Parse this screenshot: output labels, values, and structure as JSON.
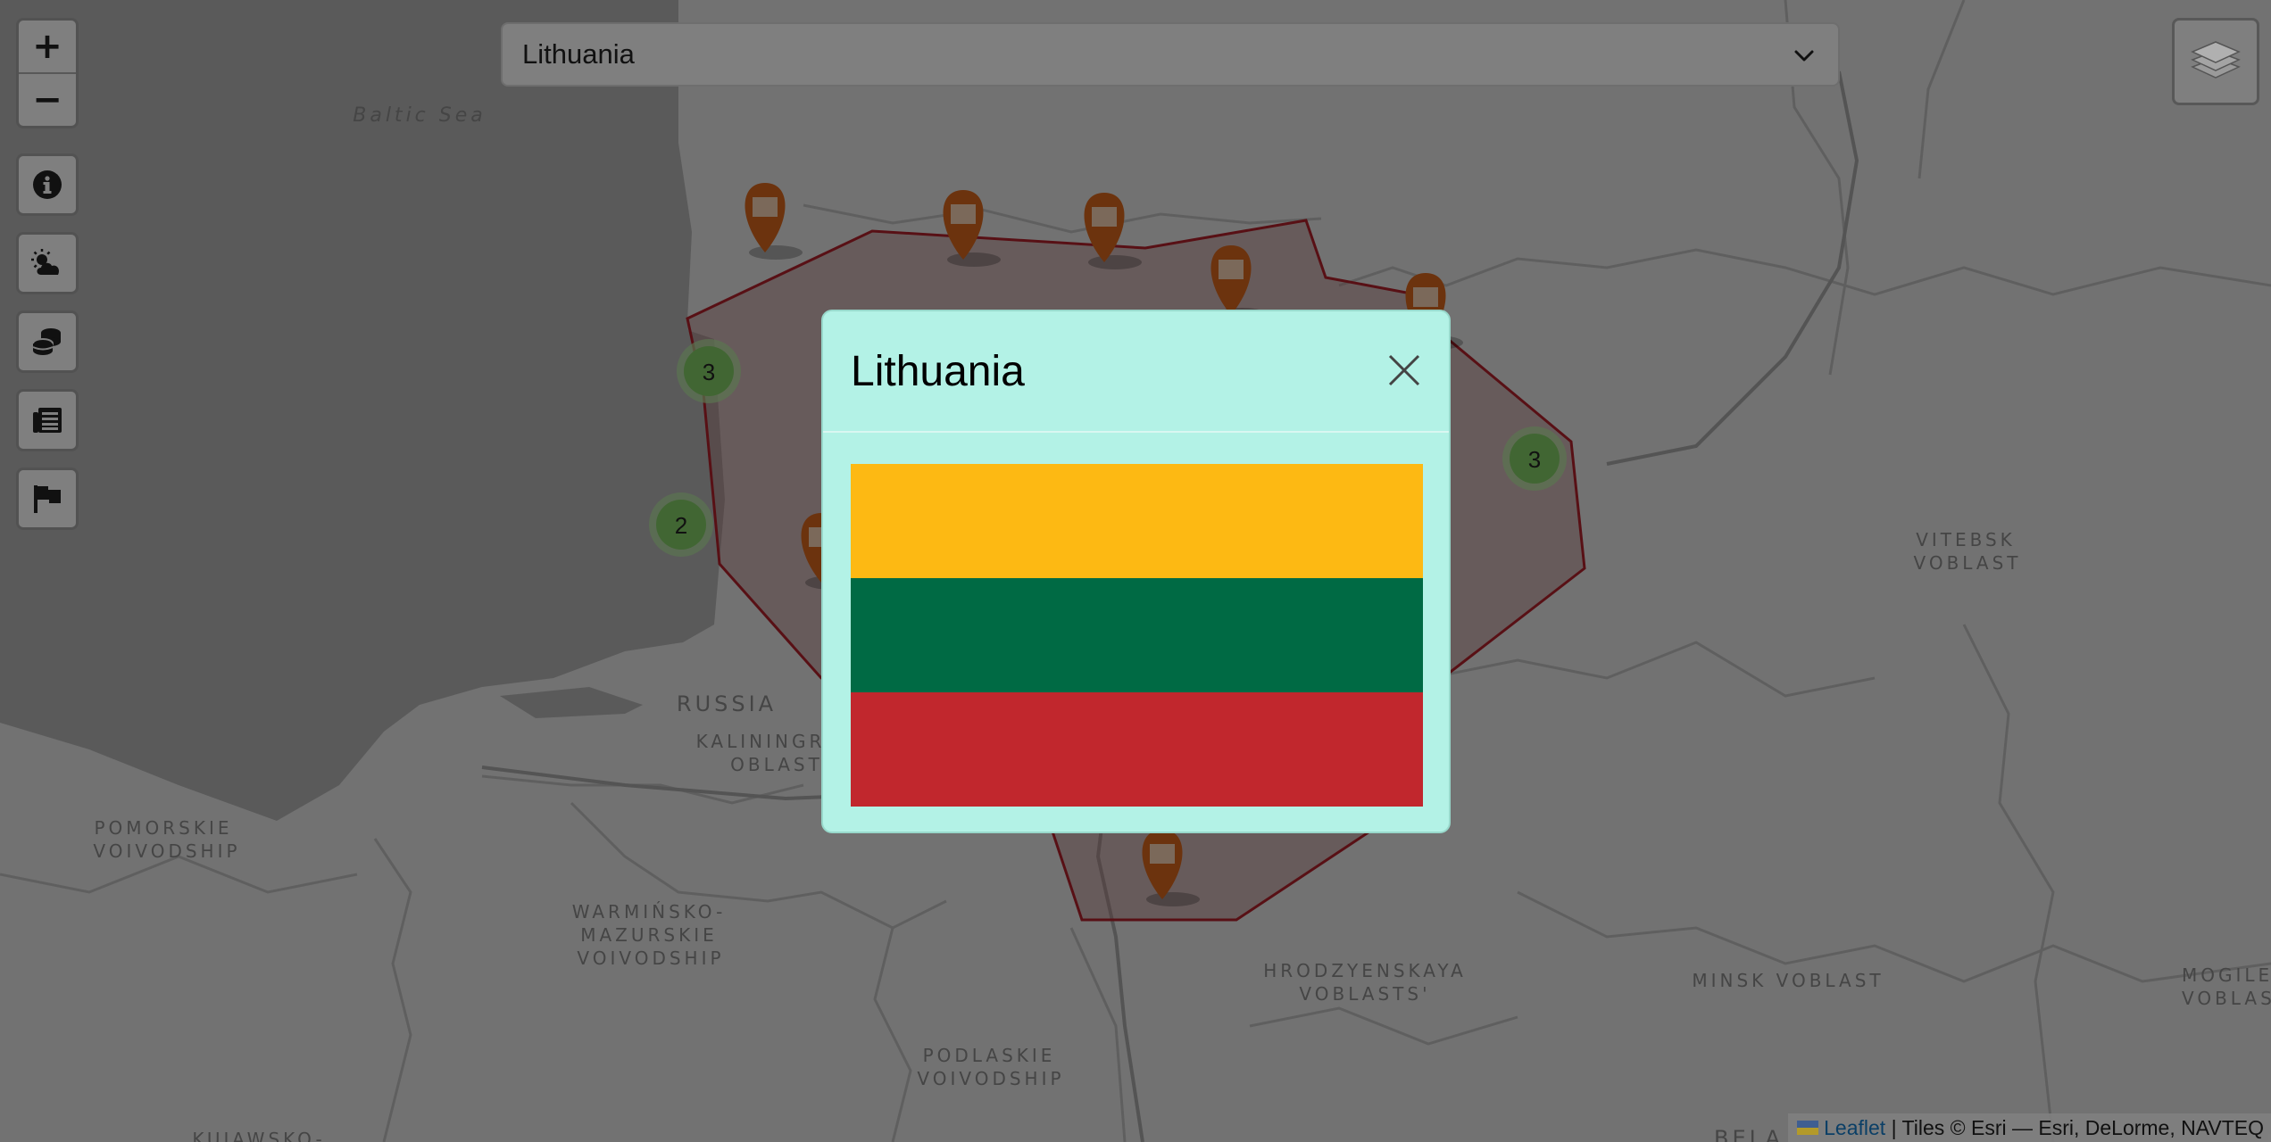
{
  "app": {
    "country_select": {
      "selected": "Lithuania"
    },
    "map": {
      "labels": {
        "baltic_sea": "Baltic Sea",
        "russia": "RUSSIA",
        "kaliningrad_1": "KALININGR",
        "kaliningrad_2": "OBLAST",
        "pomorskie_1": "POMORSKIE",
        "pomorskie_2": "VOIVODSHIP",
        "warminsko_1": "WARMIŃSKO-",
        "warminsko_2": "MAZURSKIE",
        "warminsko_3": "VOIVODSHIP",
        "podlaskie_1": "PODLASKIE",
        "podlaskie_2": "VOIVODSHIP",
        "hrodzyenskaya_1": "HRODZYENSKAYA",
        "hrodzyenskaya_2": "VOBLASTS'",
        "minsk": "MINSK VOBLAST",
        "vitebsk_1": "VITEBSK",
        "vitebsk_2": "VOBLAST",
        "mogilev_1": "MOGILE",
        "mogilev_2": "VOBLAS",
        "kujawsko": "KUJAWSKO-",
        "bela": "BELA"
      },
      "clusters": [
        {
          "count": "3"
        },
        {
          "count": "2"
        },
        {
          "count": "3"
        }
      ],
      "marker_icon": "city-building-icon",
      "border_color": "#b0202a"
    },
    "controls": {
      "zoom_in": "+",
      "zoom_out": "−",
      "buttons": [
        "info-icon",
        "weather-icon",
        "coins-icon",
        "news-icon",
        "flag-icon"
      ],
      "layers_icon": "layers-icon"
    },
    "attribution": {
      "leaflet": "Leaflet",
      "rest": "| Tiles © Esri — Esri, DeLorme, NAVTEQ"
    },
    "modal": {
      "title": "Lithuania",
      "close_icon": "close-icon",
      "flag_colors": [
        "#fdb913",
        "#006a44",
        "#c1272d"
      ]
    }
  }
}
